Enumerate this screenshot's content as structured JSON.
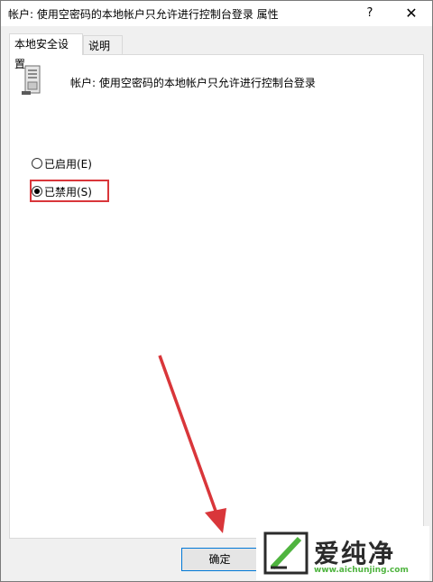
{
  "window": {
    "title": "帐户: 使用空密码的本地帐户只允许进行控制台登录 属性",
    "help_glyph": "?",
    "close_glyph": "✕"
  },
  "tabs": [
    {
      "label": "本地安全设置",
      "active": true
    },
    {
      "label": "说明",
      "active": false
    }
  ],
  "policy": {
    "icon": "server-policy-icon",
    "name": "帐户: 使用空密码的本地帐户只允许进行控制台登录"
  },
  "options": [
    {
      "label": "已启用(E)",
      "checked": false
    },
    {
      "label": "已禁用(S)",
      "checked": true
    }
  ],
  "buttons": {
    "ok_label": "确定"
  },
  "annotation": {
    "highlight_color": "#d9363a",
    "arrow_color": "#d9363a"
  },
  "watermark": {
    "brand": "爱纯净",
    "url": "www.aichunjing.com",
    "brand_color": "#2b2b2b",
    "url_color": "#4fb43f"
  }
}
